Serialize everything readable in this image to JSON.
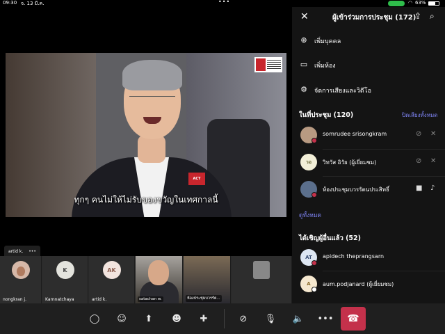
{
  "statusbar": {
    "time": "09:30",
    "date": "จ. 13 มี.ค.",
    "dots": "•••",
    "battery_text": "63%",
    "battery_level": 0.63,
    "wifi_icon": "wifi-icon",
    "call_color": "#2fbd4b"
  },
  "main_video": {
    "caption": "ทุกๆ คนไม่ให้ไม่รับของขวัญในเทศกาลนี้",
    "badge": "ACT",
    "speaker_name": "artid k.",
    "more_label": "•••"
  },
  "strip": {
    "tiles": [
      {
        "name": "nongkran j.",
        "initials": "",
        "avatar_color": "#d6b8a8"
      },
      {
        "name": "Karnnatchaya",
        "initials": "K",
        "avatar_color": "#e3e3dd"
      },
      {
        "name": "artid k.",
        "initials": "AK",
        "avatar_color": "#f2e4de"
      },
      {
        "name": "satachan w.",
        "initials": ""
      },
      {
        "name": "ห้องประชุมบวรรัต...",
        "initials": ""
      }
    ]
  },
  "panel": {
    "title": "ผู้เข้าร่วมการประชุม (172)",
    "actions": [
      {
        "label": "เพิ่มบุคคล",
        "icon": "add-person-icon"
      },
      {
        "label": "เพิ่มห้อง",
        "icon": "cast-room-icon"
      },
      {
        "label": "จัดการเสียงและวิดีโอ",
        "icon": "gear-icon"
      }
    ],
    "in_meeting_header": "ในที่ประชุม (120)",
    "mute_all": "ปิดเสียงทั้งหมด",
    "in_meeting": [
      {
        "name": "somrudee srisongkram",
        "initials": ""
      },
      {
        "name": "วิทวัส อิวัย (ผู้เยี่ยมชม)",
        "initials": "วอ"
      },
      {
        "name": "ห้องประชุมบวรรัตนประสิทธิ์",
        "initials": ""
      }
    ],
    "see_all": "ดูทั้งหมด",
    "invited_header": "ได้เชิญผู้อื่นแล้ว (52)",
    "invited": [
      {
        "name": "apidech theprangsarn",
        "initials": "AT"
      },
      {
        "name": "aum.podjanard (ผู้เยี่ยมชม)",
        "initials": "A"
      }
    ],
    "accent": "#7f85f5"
  },
  "controls": {
    "hangup_color": "#c4314b"
  }
}
